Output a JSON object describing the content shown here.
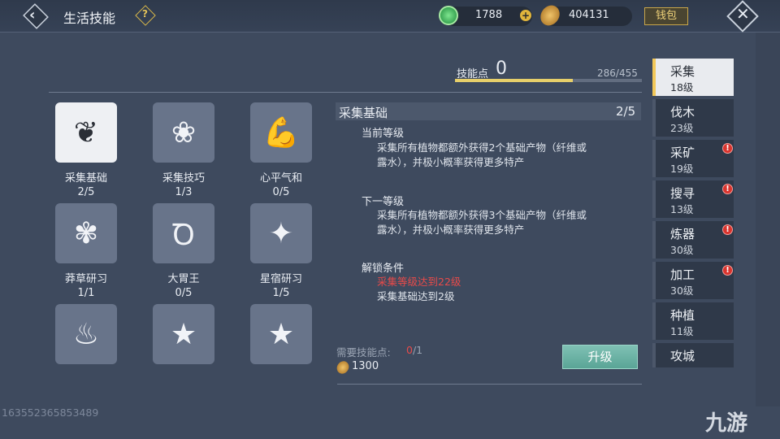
{
  "header": {
    "title": "生活技能",
    "help_icon": "?",
    "jade_value": "1788",
    "coin_value": "404131",
    "wallet_label": "钱包"
  },
  "skill_points": {
    "label": "技能点",
    "value": "0",
    "total": "286/455",
    "progress": 0.629
  },
  "skills": [
    {
      "name": "采集基础",
      "level": "2/5",
      "icon": "herb-icon",
      "glyph": "❦"
    },
    {
      "name": "采集技巧",
      "level": "1/3",
      "icon": "flower-icon",
      "glyph": "❀"
    },
    {
      "name": "心平气和",
      "level": "0/5",
      "icon": "muscle-icon",
      "glyph": "💪"
    },
    {
      "name": "莽草研习",
      "level": "1/1",
      "icon": "leaf-icon",
      "glyph": "✾"
    },
    {
      "name": "大胃王",
      "level": "0/5",
      "icon": "stomach-icon",
      "glyph": "Ꝺ"
    },
    {
      "name": "星宿研习",
      "level": "1/5",
      "icon": "constellation-icon",
      "glyph": "✦"
    },
    {
      "name": "",
      "level": "",
      "icon": "strongman-icon",
      "glyph": "♨"
    },
    {
      "name": "",
      "level": "",
      "icon": "banner-star-icon",
      "glyph": "★"
    },
    {
      "name": "",
      "level": "",
      "icon": "banner-star-icon",
      "glyph": "★"
    }
  ],
  "detail": {
    "title": "采集基础",
    "level": "2/5",
    "current_label": "当前等级",
    "current_text": "采集所有植物都额外获得2个基础产物（纤维或露水），并极小概率获得更多特产",
    "next_label": "下一等级",
    "next_text": "采集所有植物都额外获得3个基础产物（纤维或露水），并极小概率获得更多特产",
    "unlock_label": "解锁条件",
    "unlock_red": "采集等级达到22级",
    "unlock_text": "采集基础达到2级",
    "need_label": "需要技能点:",
    "need_have": "0",
    "need_total": "/1",
    "cost": "1300",
    "upgrade_label": "升级"
  },
  "tabs": [
    {
      "name": "采集",
      "level": "18级",
      "active": true,
      "alert": false
    },
    {
      "name": "伐木",
      "level": "23级",
      "active": false,
      "alert": false
    },
    {
      "name": "采矿",
      "level": "19级",
      "active": false,
      "alert": true
    },
    {
      "name": "搜寻",
      "level": "13级",
      "active": false,
      "alert": true
    },
    {
      "name": "炼器",
      "level": "30级",
      "active": false,
      "alert": true
    },
    {
      "name": "加工",
      "level": "30级",
      "active": false,
      "alert": true
    },
    {
      "name": "种植",
      "level": "11级",
      "active": false,
      "alert": false
    },
    {
      "name": "攻城",
      "level": "",
      "active": false,
      "alert": false
    }
  ],
  "footer": {
    "id_text": "163552365853489",
    "watermark": "九游"
  },
  "colors": {
    "background": "#3e4a5e",
    "accent_gold": "#e7cf6a",
    "alert_red": "#e84a4a",
    "upgrade_green": "#6fb3a5"
  }
}
